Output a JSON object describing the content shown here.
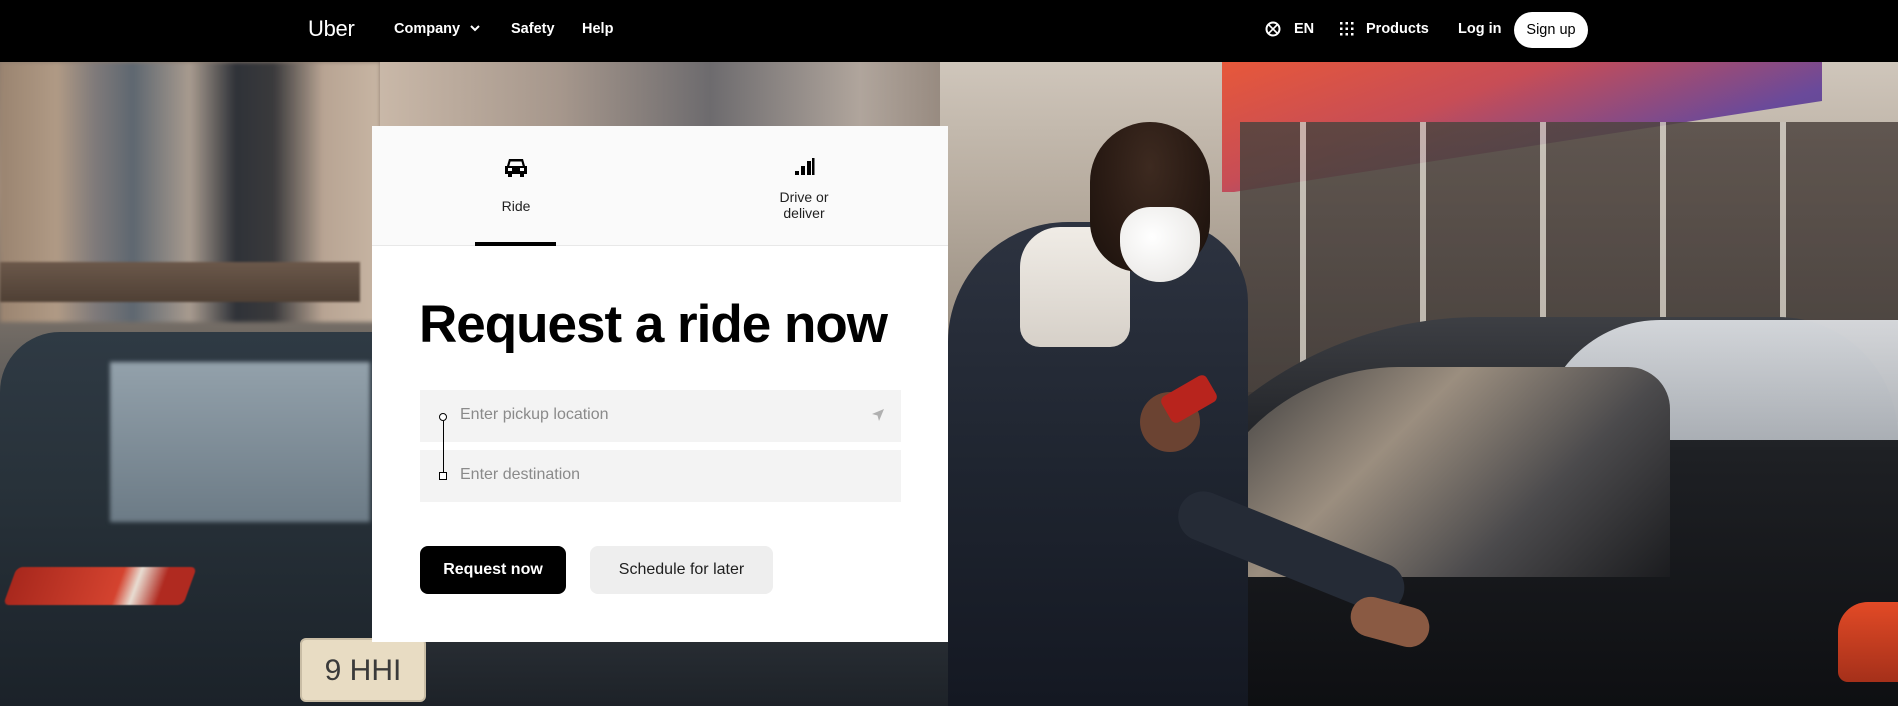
{
  "nav": {
    "logo": "Uber",
    "items": [
      {
        "label": "Company",
        "has_dropdown": true
      },
      {
        "label": "Safety"
      },
      {
        "label": "Help"
      }
    ],
    "language": "EN",
    "products": "Products",
    "login": "Log in",
    "signup": "Sign up"
  },
  "card": {
    "tabs": [
      {
        "label": "Ride",
        "icon": "car-icon",
        "active": true
      },
      {
        "label": "Drive or\ndeliver",
        "icon": "signal-bars-icon",
        "active": false
      }
    ],
    "title": "Request a ride now",
    "pickup": {
      "placeholder": "Enter pickup location",
      "value": ""
    },
    "destination": {
      "placeholder": "Enter destination",
      "value": ""
    },
    "buttons": {
      "request": "Request now",
      "schedule": "Schedule for later"
    }
  },
  "hero": {
    "license_plate": "9 HHI"
  },
  "colors": {
    "primary": "#000000",
    "background_nav": "#000000",
    "input_bg": "#f3f3f3",
    "secondary_button": "#eeeeee"
  }
}
